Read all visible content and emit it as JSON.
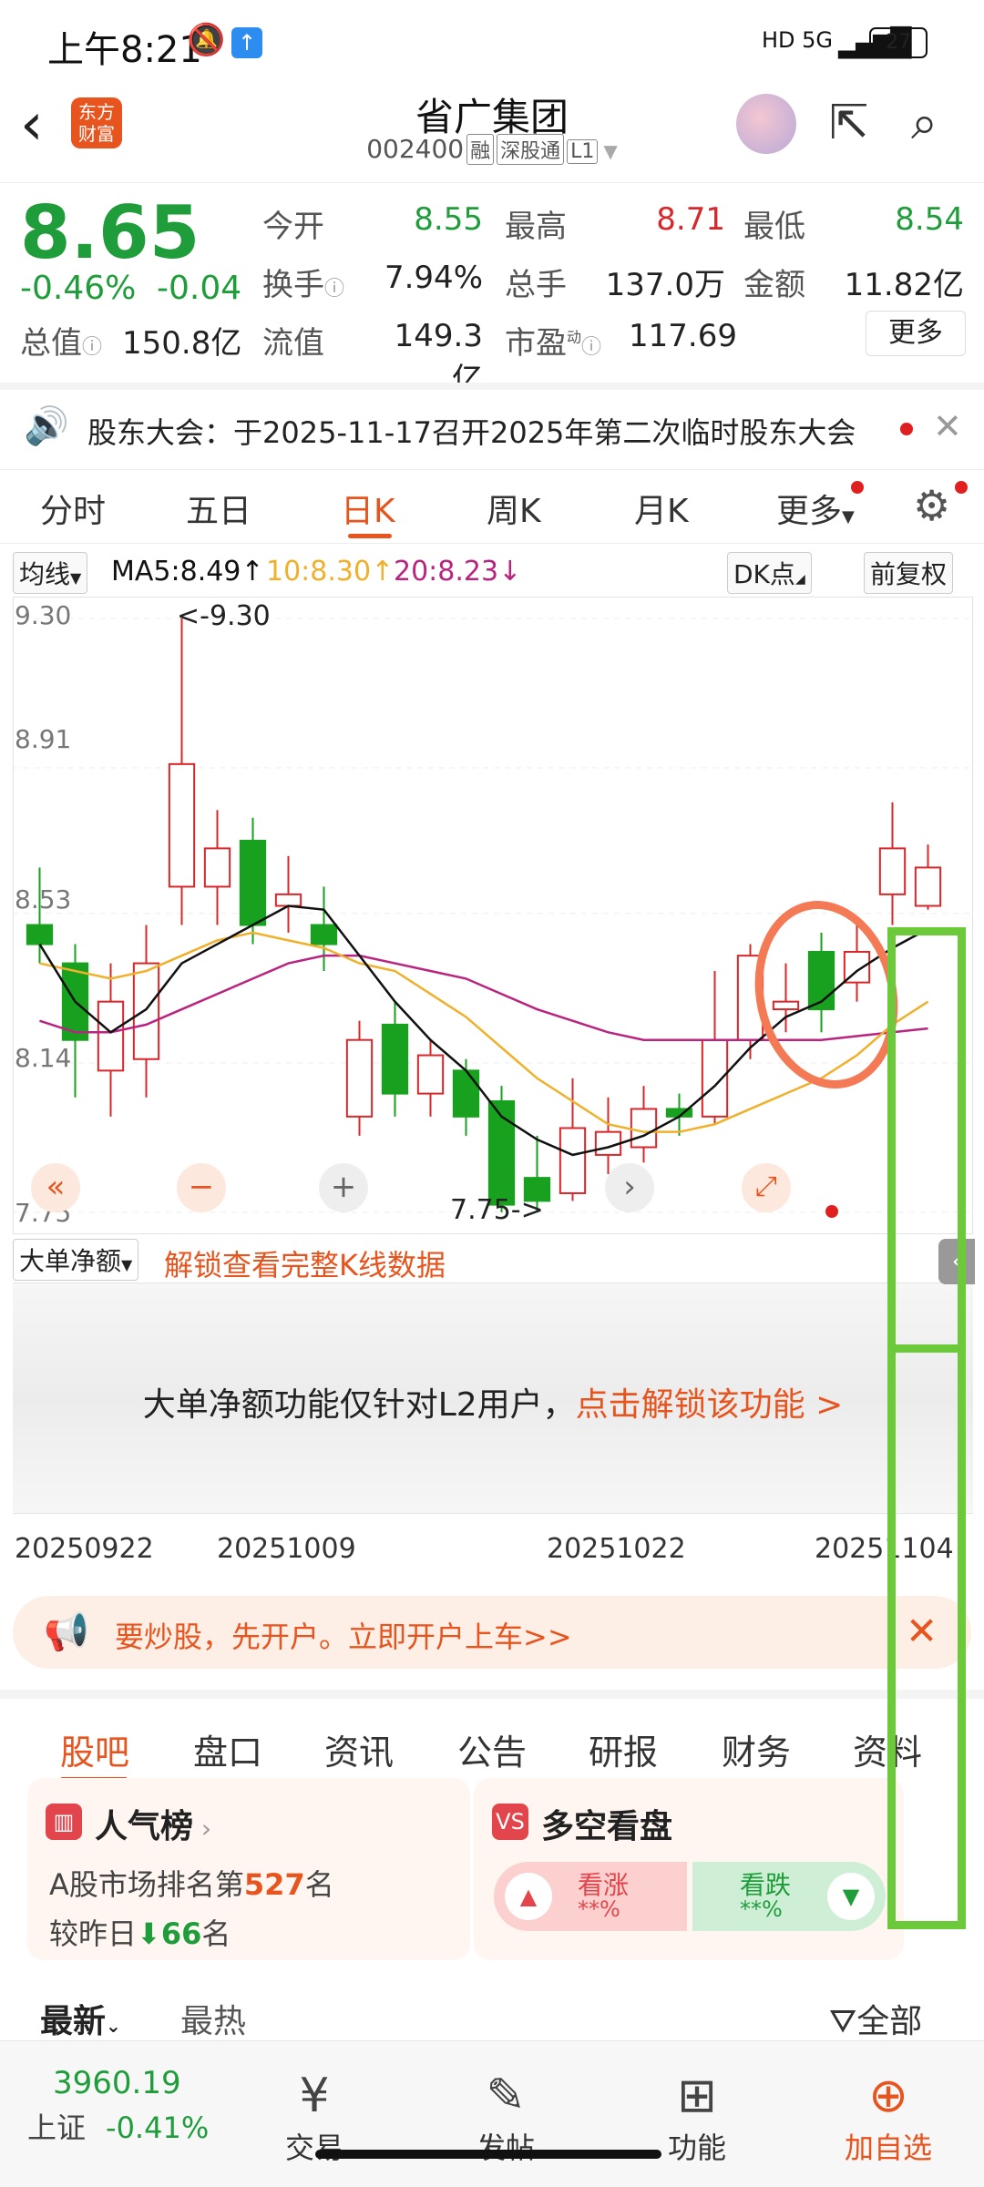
{
  "status_bar": {
    "time": "上午8:21",
    "network": "HD 5G",
    "battery": "27"
  },
  "header": {
    "stock_name": "省广集团",
    "stock_code": "002400",
    "tags": [
      "融",
      "深股通",
      "L1"
    ],
    "logo_text": "东方财富"
  },
  "quote": {
    "price": "8.65",
    "change_pct": "-0.46%",
    "change": "-0.04",
    "fields": [
      {
        "label": "今开",
        "value": "8.55",
        "color": "green"
      },
      {
        "label": "最高",
        "value": "8.71",
        "color": "red"
      },
      {
        "label": "最低",
        "value": "8.54",
        "color": "green"
      },
      {
        "label": "换手",
        "value": "7.94%",
        "color": "normal"
      },
      {
        "label": "总手",
        "value": "137.0万",
        "color": "normal"
      },
      {
        "label": "金额",
        "value": "11.82亿",
        "color": "normal"
      }
    ],
    "row3": {
      "total_value_label": "总值",
      "total_value": "150.8亿",
      "float_value_label": "流值",
      "float_value": "149.3亿",
      "pe_label": "市盈",
      "pe_sup": "动",
      "pe_value": "117.69",
      "more": "更多"
    }
  },
  "notice": {
    "text": "股东大会：于2025-11-17召开2025年第二次临时股东大会"
  },
  "kline_tabs": {
    "items": [
      "分时",
      "五日",
      "日K",
      "周K",
      "月K",
      "更多"
    ],
    "active": "日K"
  },
  "ma_bar": {
    "type_select": "均线",
    "ma5": "MA5:8.49",
    "ma10": "10:8.30",
    "ma20": "20:8.23",
    "dk_button": "DK点",
    "fq_button": "前复权"
  },
  "chart_data": {
    "type": "candlestick",
    "y_ticks": [
      "9.30",
      "8.91",
      "8.53",
      "8.14",
      "7.75"
    ],
    "ylim": [
      7.75,
      9.3
    ],
    "high_annotation": "<-9.30",
    "low_annotation": "7.75->",
    "x_labels": [
      "20250922",
      "20251009",
      "20251022",
      "20251104"
    ],
    "candles": [
      {
        "o": 8.5,
        "c": 8.45,
        "h": 8.65,
        "l": 8.4
      },
      {
        "o": 8.4,
        "c": 8.2,
        "h": 8.45,
        "l": 8.05
      },
      {
        "o": 8.12,
        "c": 8.3,
        "h": 8.4,
        "l": 8.0
      },
      {
        "o": 8.15,
        "c": 8.4,
        "h": 8.5,
        "l": 8.05
      },
      {
        "o": 8.6,
        "c": 8.92,
        "h": 9.3,
        "l": 8.5
      },
      {
        "o": 8.6,
        "c": 8.7,
        "h": 8.8,
        "l": 8.5
      },
      {
        "o": 8.72,
        "c": 8.5,
        "h": 8.78,
        "l": 8.45
      },
      {
        "o": 8.55,
        "c": 8.58,
        "h": 8.68,
        "l": 8.48
      },
      {
        "o": 8.5,
        "c": 8.45,
        "h": 8.6,
        "l": 8.38
      },
      {
        "o": 8.0,
        "c": 8.2,
        "h": 8.25,
        "l": 7.95
      },
      {
        "o": 8.24,
        "c": 8.06,
        "h": 8.3,
        "l": 8.0
      },
      {
        "o": 8.06,
        "c": 8.16,
        "h": 8.2,
        "l": 8.0
      },
      {
        "o": 8.12,
        "c": 8.0,
        "h": 8.15,
        "l": 7.95
      },
      {
        "o": 8.04,
        "c": 7.77,
        "h": 8.08,
        "l": 7.75
      },
      {
        "o": 7.84,
        "c": 7.78,
        "h": 7.95,
        "l": 7.75
      },
      {
        "o": 7.8,
        "c": 7.97,
        "h": 8.1,
        "l": 7.78
      },
      {
        "o": 7.9,
        "c": 7.96,
        "h": 8.05,
        "l": 7.85
      },
      {
        "o": 7.92,
        "c": 8.02,
        "h": 8.08,
        "l": 7.88
      },
      {
        "o": 8.02,
        "c": 8.0,
        "h": 8.06,
        "l": 7.95
      },
      {
        "o": 8.0,
        "c": 8.2,
        "h": 8.38,
        "l": 7.98
      },
      {
        "o": 8.2,
        "c": 8.42,
        "h": 8.45,
        "l": 8.15
      },
      {
        "o": 8.28,
        "c": 8.3,
        "h": 8.4,
        "l": 8.22
      },
      {
        "o": 8.43,
        "c": 8.28,
        "h": 8.48,
        "l": 8.22
      },
      {
        "o": 8.35,
        "c": 8.43,
        "h": 8.5,
        "l": 8.3
      },
      {
        "o": 8.58,
        "c": 8.7,
        "h": 8.82,
        "l": 8.5
      },
      {
        "o": 8.55,
        "c": 8.65,
        "h": 8.71,
        "l": 8.54
      }
    ],
    "ma5": [
      8.45,
      8.3,
      8.22,
      8.28,
      8.4,
      8.45,
      8.5,
      8.55,
      8.54,
      8.42,
      8.3,
      8.2,
      8.12,
      8.0,
      7.94,
      7.9,
      7.92,
      7.95,
      8.0,
      8.08,
      8.18,
      8.26,
      8.3,
      8.38,
      8.44,
      8.49
    ],
    "ma10": [
      8.4,
      8.38,
      8.36,
      8.38,
      8.42,
      8.46,
      8.48,
      8.46,
      8.44,
      8.4,
      8.38,
      8.32,
      8.26,
      8.18,
      8.1,
      8.04,
      7.98,
      7.96,
      7.96,
      7.98,
      8.02,
      8.06,
      8.1,
      8.16,
      8.24,
      8.3
    ],
    "ma20": [
      8.25,
      8.22,
      8.22,
      8.24,
      8.28,
      8.32,
      8.36,
      8.4,
      8.42,
      8.42,
      8.4,
      8.38,
      8.36,
      8.32,
      8.28,
      8.25,
      8.22,
      8.2,
      8.2,
      8.2,
      8.2,
      8.2,
      8.2,
      8.21,
      8.22,
      8.23
    ],
    "colors": {
      "up": "#d8272a",
      "down": "#18a01f",
      "ma5": "#111111",
      "ma10": "#f0b02a",
      "ma20": "#b8247f"
    }
  },
  "indicator": {
    "select": "大单净额",
    "unlock_link": "解锁查看完整K线数据",
    "locked_text": "大单净额功能仅针对L2用户，",
    "locked_link": "点击解锁该功能 >"
  },
  "ad": {
    "text": "要炒股，先开户。立即开户上车>>"
  },
  "bottom_tabs": {
    "items": [
      "股吧",
      "盘口",
      "资讯",
      "公告",
      "研报",
      "财务",
      "资料"
    ],
    "active": "股吧"
  },
  "popularity_card": {
    "title": "人气榜",
    "rank_prefix": "A股市场排名第",
    "rank": "527",
    "rank_suffix": "名",
    "change_prefix": "较昨日",
    "change": "66",
    "change_suffix": "名"
  },
  "sentiment_card": {
    "title": "多空看盘",
    "bull_label": "看涨",
    "bull_value": "**%",
    "bear_label": "看跌",
    "bear_value": "**%"
  },
  "sort_row": {
    "latest": "最新",
    "hottest": "最热",
    "all": "全部"
  },
  "bottom_nav": {
    "index_value": "3960.19",
    "index_name": "上证",
    "index_change": "-0.41%",
    "items": [
      "交易",
      "发帖",
      "功能",
      "加自选"
    ]
  }
}
